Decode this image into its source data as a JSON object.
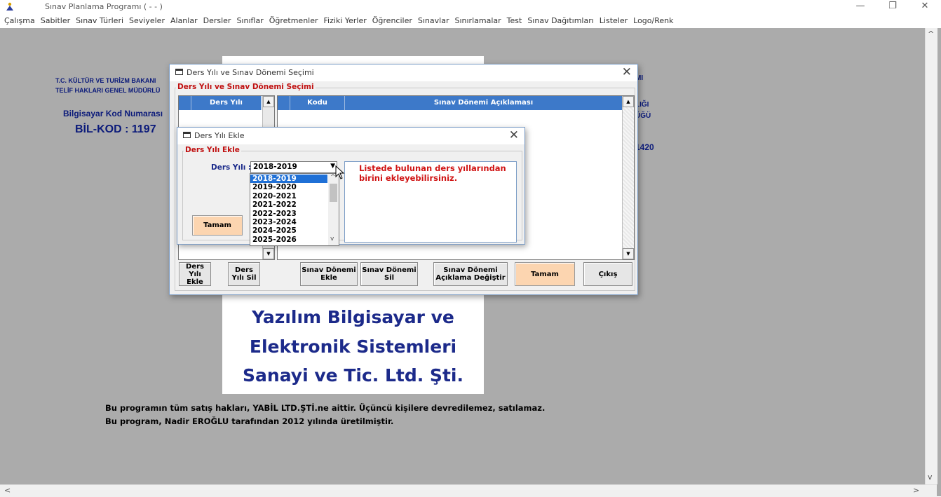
{
  "window": {
    "title": "Sınav Planlama Programı ( -  - )"
  },
  "menu": [
    "Çalışma",
    "Sabitler",
    "Sınav Türleri",
    "Seviyeler",
    "Alanlar",
    "Dersler",
    "Sınıflar",
    "Öğretmenler",
    "Fiziki Yerler",
    "Öğrenciler",
    "Sınavlar",
    "Sınırlamalar",
    "Test",
    "Sınav Dağıtımları",
    "Listeler",
    "Logo/Renk"
  ],
  "background": {
    "ministry_line1": "T.C. KÜLTÜR VE TURİZM BAKANI",
    "ministry_line2": "TELİF HAKLARI GENEL MÜDÜRLÜ",
    "code_label": "Bilgisayar Kod Numarası",
    "bil_kod": "BİL-KOD : 1197",
    "right_frag1": "MI",
    "right_frag2": "LIĞI",
    "right_frag3": "ÜĞÜ",
    "right_frag4": "1420",
    "company_line1": "Yazılım Bilgisayar  ve",
    "company_line2": "Elektronik Sistemleri",
    "company_line3": "Sanayi ve Tic. Ltd. Şti.",
    "footer_line1": "Bu programın tüm satış hakları, YABİL LTD.ŞTİ.ne aittir. Üçüncü kişilere devredilemez, satılamaz.",
    "footer_line2": "Bu program, Nadir EROĞLU tarafından 2012 yılında üretilmiştir."
  },
  "main_dialog": {
    "title": "Ders Yılı ve Sınav Dönemi Seçimi",
    "group_label": "Ders Yılı ve Sınav Dönemi Seçimi",
    "grid1_header": "Ders Yılı",
    "grid2_headers": [
      "Kodu",
      "Sınav Dönemi Açıklaması"
    ],
    "buttons": {
      "add_year": "Ders Yılı Ekle",
      "delete_year": "Ders Yılı Sil",
      "add_exam": "Sınav Dönemi Ekle",
      "delete_exam": "Sınav Dönemi Sil",
      "change_desc": "Sınav Dönemi Açıklama Değiştir",
      "ok": "Tamam",
      "exit": "Çıkış"
    }
  },
  "add_dialog": {
    "title": "Ders Yılı Ekle",
    "group_label": "Ders Yılı Ekle",
    "field_label": "Ders Yılı :",
    "selected_value": "2018-2019",
    "options": [
      "2018-2019",
      "2019-2020",
      "2020-2021",
      "2021-2022",
      "2022-2023",
      "2023-2024",
      "2024-2025",
      "2025-2026"
    ],
    "info_text": "Listede bulunan ders yıllarından birini ekleyebilirsiniz.",
    "ok_label": "Tamam"
  },
  "colors": {
    "accent_blue": "#3d79c9",
    "selection": "#1f70d6",
    "group_label": "#c01010",
    "ok_button": "#fcd5b0"
  }
}
